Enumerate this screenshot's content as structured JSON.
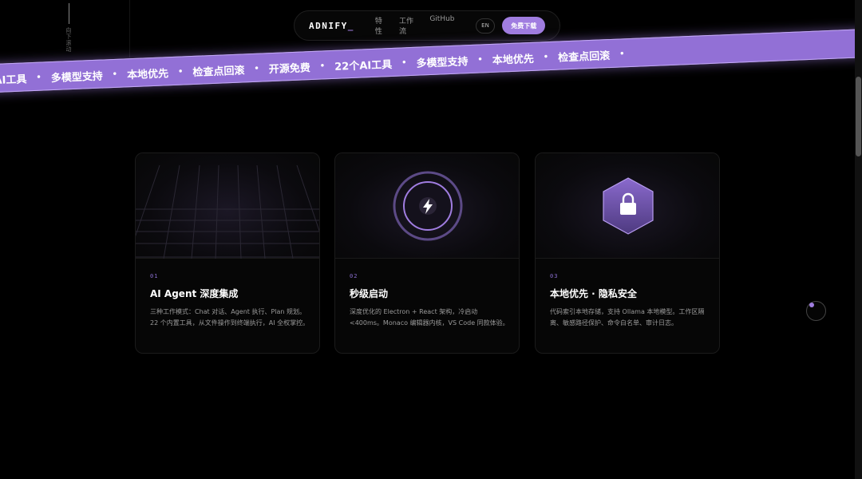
{
  "side": {
    "label": "向下滚动"
  },
  "nav": {
    "logo": "ADNIFY",
    "logo_cursor": "_",
    "links": [
      "特性",
      "工作流",
      "GitHub"
    ],
    "lang": "EN",
    "download": "免费下载"
  },
  "ribbon": {
    "items": [
      "AI工具",
      "多模型支持",
      "本地优先",
      "检查点回滚",
      "开源免费",
      "22个AI工具",
      "多模型支持",
      "本地优先",
      "检查点回滚"
    ],
    "separator": "•"
  },
  "cards": [
    {
      "num": "01",
      "title": "AI Agent 深度集成",
      "desc": "三种工作模式：Chat 对话、Agent 执行、Plan 规划。22 个内置工具，从文件操作到终端执行，AI 全权掌控。",
      "icon": "grid-perspective-icon"
    },
    {
      "num": "02",
      "title": "秒级启动",
      "desc": "深度优化的 Electron + React 架构，冷启动 <400ms。Monaco 编辑器内核，VS Code 同款体验。",
      "icon": "lightning-icon"
    },
    {
      "num": "03",
      "title": "本地优先 · 隐私安全",
      "desc": "代码索引本地存储，支持 Ollama 本地模型。工作区隔离、敏感路径保护、命令白名单、审计日志。",
      "icon": "lock-icon"
    }
  ],
  "colors": {
    "accent": "#a07de0",
    "ribbon": "#9270d6",
    "background": "#000000"
  }
}
